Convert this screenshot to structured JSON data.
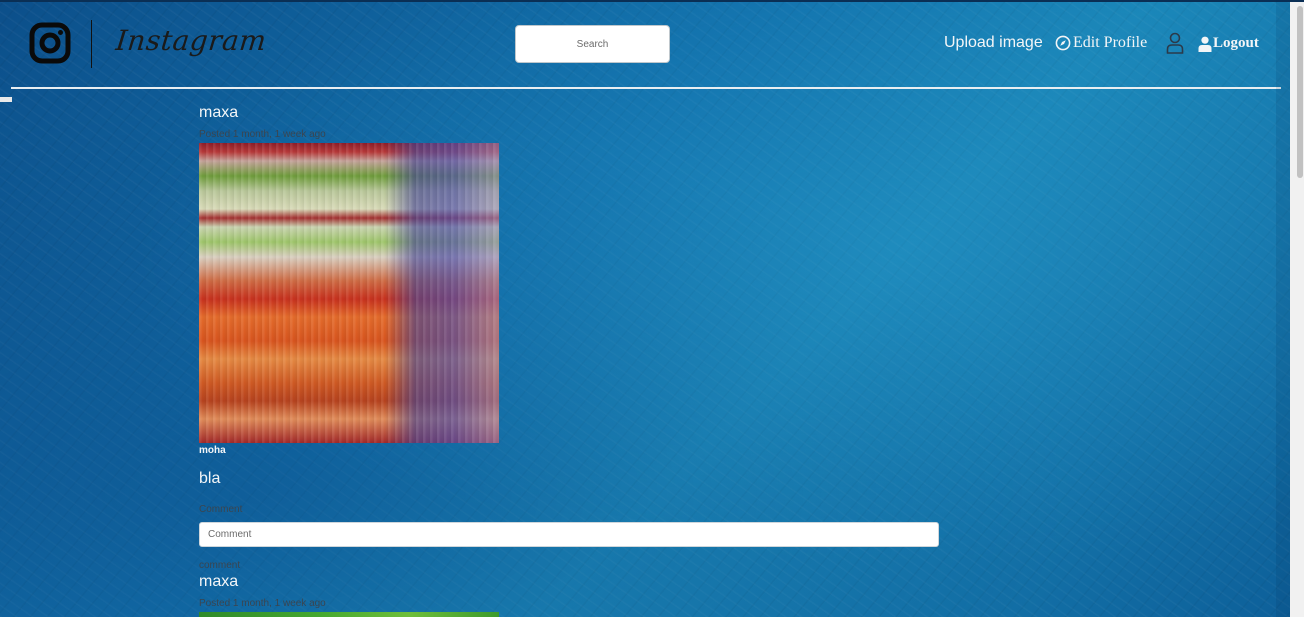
{
  "header": {
    "brand": "Instagram",
    "search_placeholder": "Search",
    "upload_label": "Upload image",
    "edit_profile_label": "Edit Profile",
    "logout_label": "Logout"
  },
  "icons": {
    "logo": "instagram-logo-icon",
    "compass": "compass-icon",
    "profile": "person-outline-icon",
    "logout": "person-filled-icon"
  },
  "posts": [
    {
      "user": "maxa",
      "time": "Posted 1 month, 1 week ago",
      "caption_user": "moha",
      "caption": "bla",
      "comment_label": "Comment",
      "comment_placeholder": "Comment",
      "comments": [
        "comment"
      ]
    },
    {
      "user": "maxa",
      "time": "Posted 1 month, 1 week ago"
    }
  ],
  "colors": {
    "background": "#1272ad",
    "nav_text": "#f3f5f7",
    "divider": "#e8eef2"
  }
}
